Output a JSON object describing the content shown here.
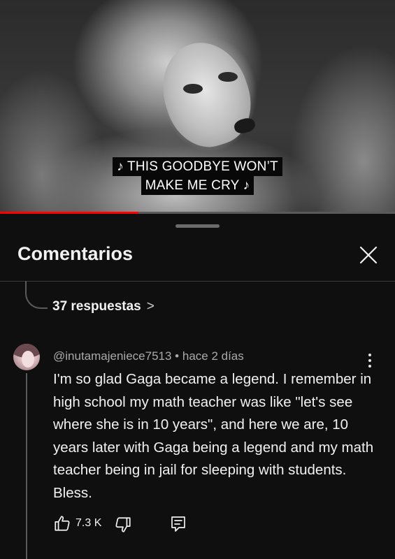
{
  "video": {
    "caption_lines": [
      "♪ THIS GOODBYE WON’T",
      "MAKE ME CRY ♪"
    ],
    "progress": 0.35,
    "progress_color": "#ff0000"
  },
  "panel": {
    "title": "Comentarios",
    "close_icon": "close-icon",
    "replies_link": "37 respuestas"
  },
  "comment": {
    "author": "@inutamajeniece7513",
    "separator": "•",
    "time": "hace 2 días",
    "text": "I'm so glad Gaga became a legend. I remember in high school my math teacher was like \"let's see where she is in 10 years\", and here we are, 10 years later with Gaga being a legend and my math teacher being in jail for sleeping with students. Bless.",
    "likes": "7.3 K",
    "icons": {
      "like": "thumbs-up-icon",
      "dislike": "thumbs-down-icon",
      "reply": "reply-comment-icon",
      "more": "more-vertical-icon"
    }
  },
  "colors": {
    "background": "#0f0f0f",
    "text_primary": "#f1f1f1",
    "text_secondary": "#aaaaaa"
  }
}
